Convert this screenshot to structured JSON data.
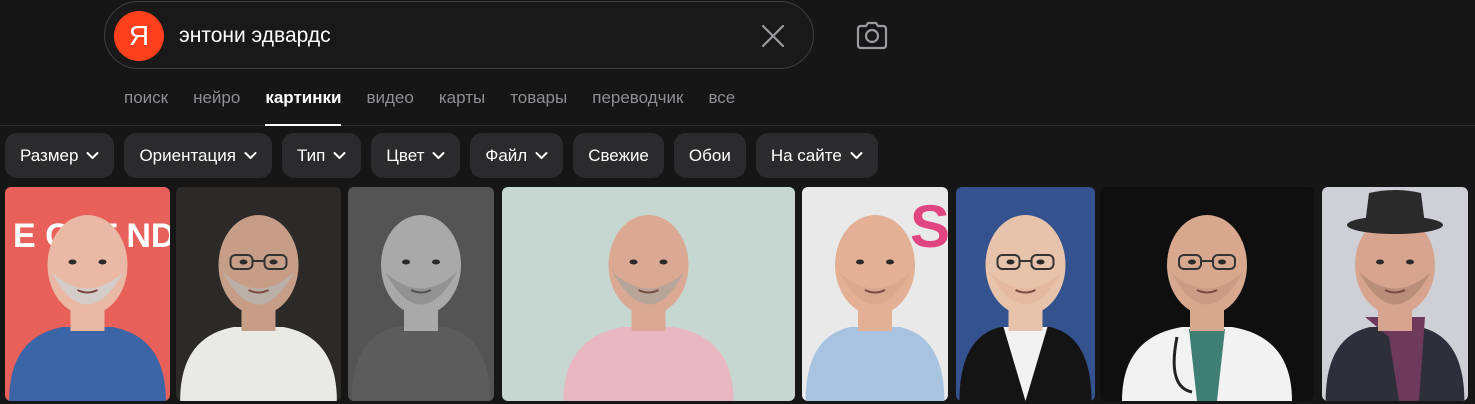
{
  "search": {
    "query": "энтони эдвардс",
    "logo_letter": "Я"
  },
  "tabs": [
    {
      "label": "поиск",
      "active": false
    },
    {
      "label": "нейро",
      "active": false
    },
    {
      "label": "картинки",
      "active": true
    },
    {
      "label": "видео",
      "active": false
    },
    {
      "label": "карты",
      "active": false
    },
    {
      "label": "товары",
      "active": false
    },
    {
      "label": "переводчик",
      "active": false
    },
    {
      "label": "все",
      "active": false
    }
  ],
  "filters": [
    {
      "label": "Размер",
      "dropdown": true
    },
    {
      "label": "Ориентация",
      "dropdown": true
    },
    {
      "label": "Тип",
      "dropdown": true
    },
    {
      "label": "Цвет",
      "dropdown": true
    },
    {
      "label": "Файл",
      "dropdown": true
    },
    {
      "label": "Свежие",
      "dropdown": false
    },
    {
      "label": "Обои",
      "dropdown": false
    },
    {
      "label": "На сайте",
      "dropdown": true
    }
  ],
  "images": [
    {
      "bg": "#e8605a",
      "face": "#e9b9a6",
      "shirt": "#3b65a6",
      "beard": "#cfcfcf",
      "text": "E OUT   NDS",
      "text_color": "#ffffff"
    },
    {
      "bg": "#2b2a28",
      "face": "#c69e88",
      "shirt": "#e9e9e6",
      "beard": "#b9b3ad",
      "glasses": true
    },
    {
      "bg": "#545454",
      "face": "#a9a9a9",
      "shirt": "#5c5c5c",
      "beard": "#8e8e8e",
      "gray": true
    },
    {
      "bg": "#c6d7d1",
      "face": "#dba893",
      "shirt": "#e8b7c1",
      "beard": "#b0a49a"
    },
    {
      "bg": "#e9e9ea",
      "face": "#e4b095",
      "shirt": "#a7c3e0",
      "beard": "#d8a68e",
      "text": "SI",
      "text_color": "#e0457f"
    },
    {
      "bg": "#33528e",
      "face": "#e8c3ac",
      "shirt": "#f2f2f2",
      "beard": "#e2b7a0",
      "glasses": true,
      "suit": "#141414"
    },
    {
      "bg": "#0f0f0f",
      "face": "#d7a88e",
      "shirt": "#f2f2f2",
      "beard": "#c89a82",
      "glasses": true,
      "doctor": true
    },
    {
      "bg": "#cfcfd6",
      "face": "#d7a58f",
      "shirt": "#2e2f3a",
      "beard": "#b48a78",
      "hat": true,
      "scarf": "#6d3a5c"
    }
  ]
}
